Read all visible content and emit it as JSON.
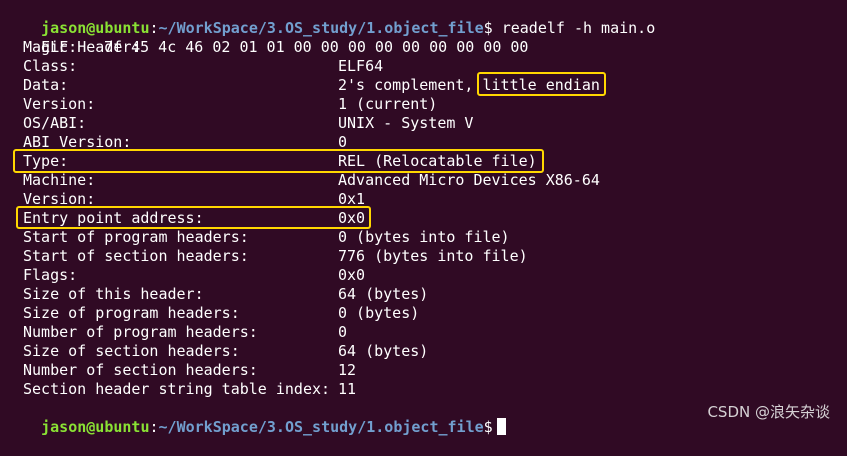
{
  "prompt": {
    "user_host": "jason@ubuntu",
    "colon": ":",
    "path": "~/WorkSpace/3.OS_study/1.object_file",
    "dollar": "$",
    "command": " readelf -h main.o"
  },
  "header_title": "ELF Header:",
  "magic": {
    "label": "Magic:",
    "value": "7f 45 4c 46 02 01 01 00 00 00 00 00 00 00 00 00"
  },
  "fields": [
    {
      "label": "Class:",
      "value": "ELF64"
    },
    {
      "label": "Data:",
      "value": "2's complement, ",
      "value_highlight": "little endian"
    },
    {
      "label": "Version:",
      "value": "1 (current)"
    },
    {
      "label": "OS/ABI:",
      "value": "UNIX - System V"
    },
    {
      "label": "ABI Version:",
      "value": "0"
    },
    {
      "label": "Type:",
      "value": "REL (Relocatable file)"
    },
    {
      "label": "Machine:",
      "value": "Advanced Micro Devices X86-64"
    },
    {
      "label": "Version:",
      "value": "0x1"
    },
    {
      "label": "Entry point address:",
      "value": "0x0"
    },
    {
      "label": "Start of program headers:",
      "value": "0 (bytes into file)"
    },
    {
      "label": "Start of section headers:",
      "value": "776 (bytes into file)"
    },
    {
      "label": "Flags:",
      "value": "0x0"
    },
    {
      "label": "Size of this header:",
      "value": "64 (bytes)"
    },
    {
      "label": "Size of program headers:",
      "value": "0 (bytes)"
    },
    {
      "label": "Number of program headers:",
      "value": "0"
    },
    {
      "label": "Size of section headers:",
      "value": "64 (bytes)"
    },
    {
      "label": "Number of section headers:",
      "value": "12"
    },
    {
      "label": "Section header string table index:",
      "value": "11"
    }
  ],
  "watermark": "CSDN @浪矢杂谈",
  "colors": {
    "background": "#300a24",
    "prompt_user": "#8ae234",
    "prompt_path": "#729fcf",
    "highlight_box": "#ffd700"
  }
}
